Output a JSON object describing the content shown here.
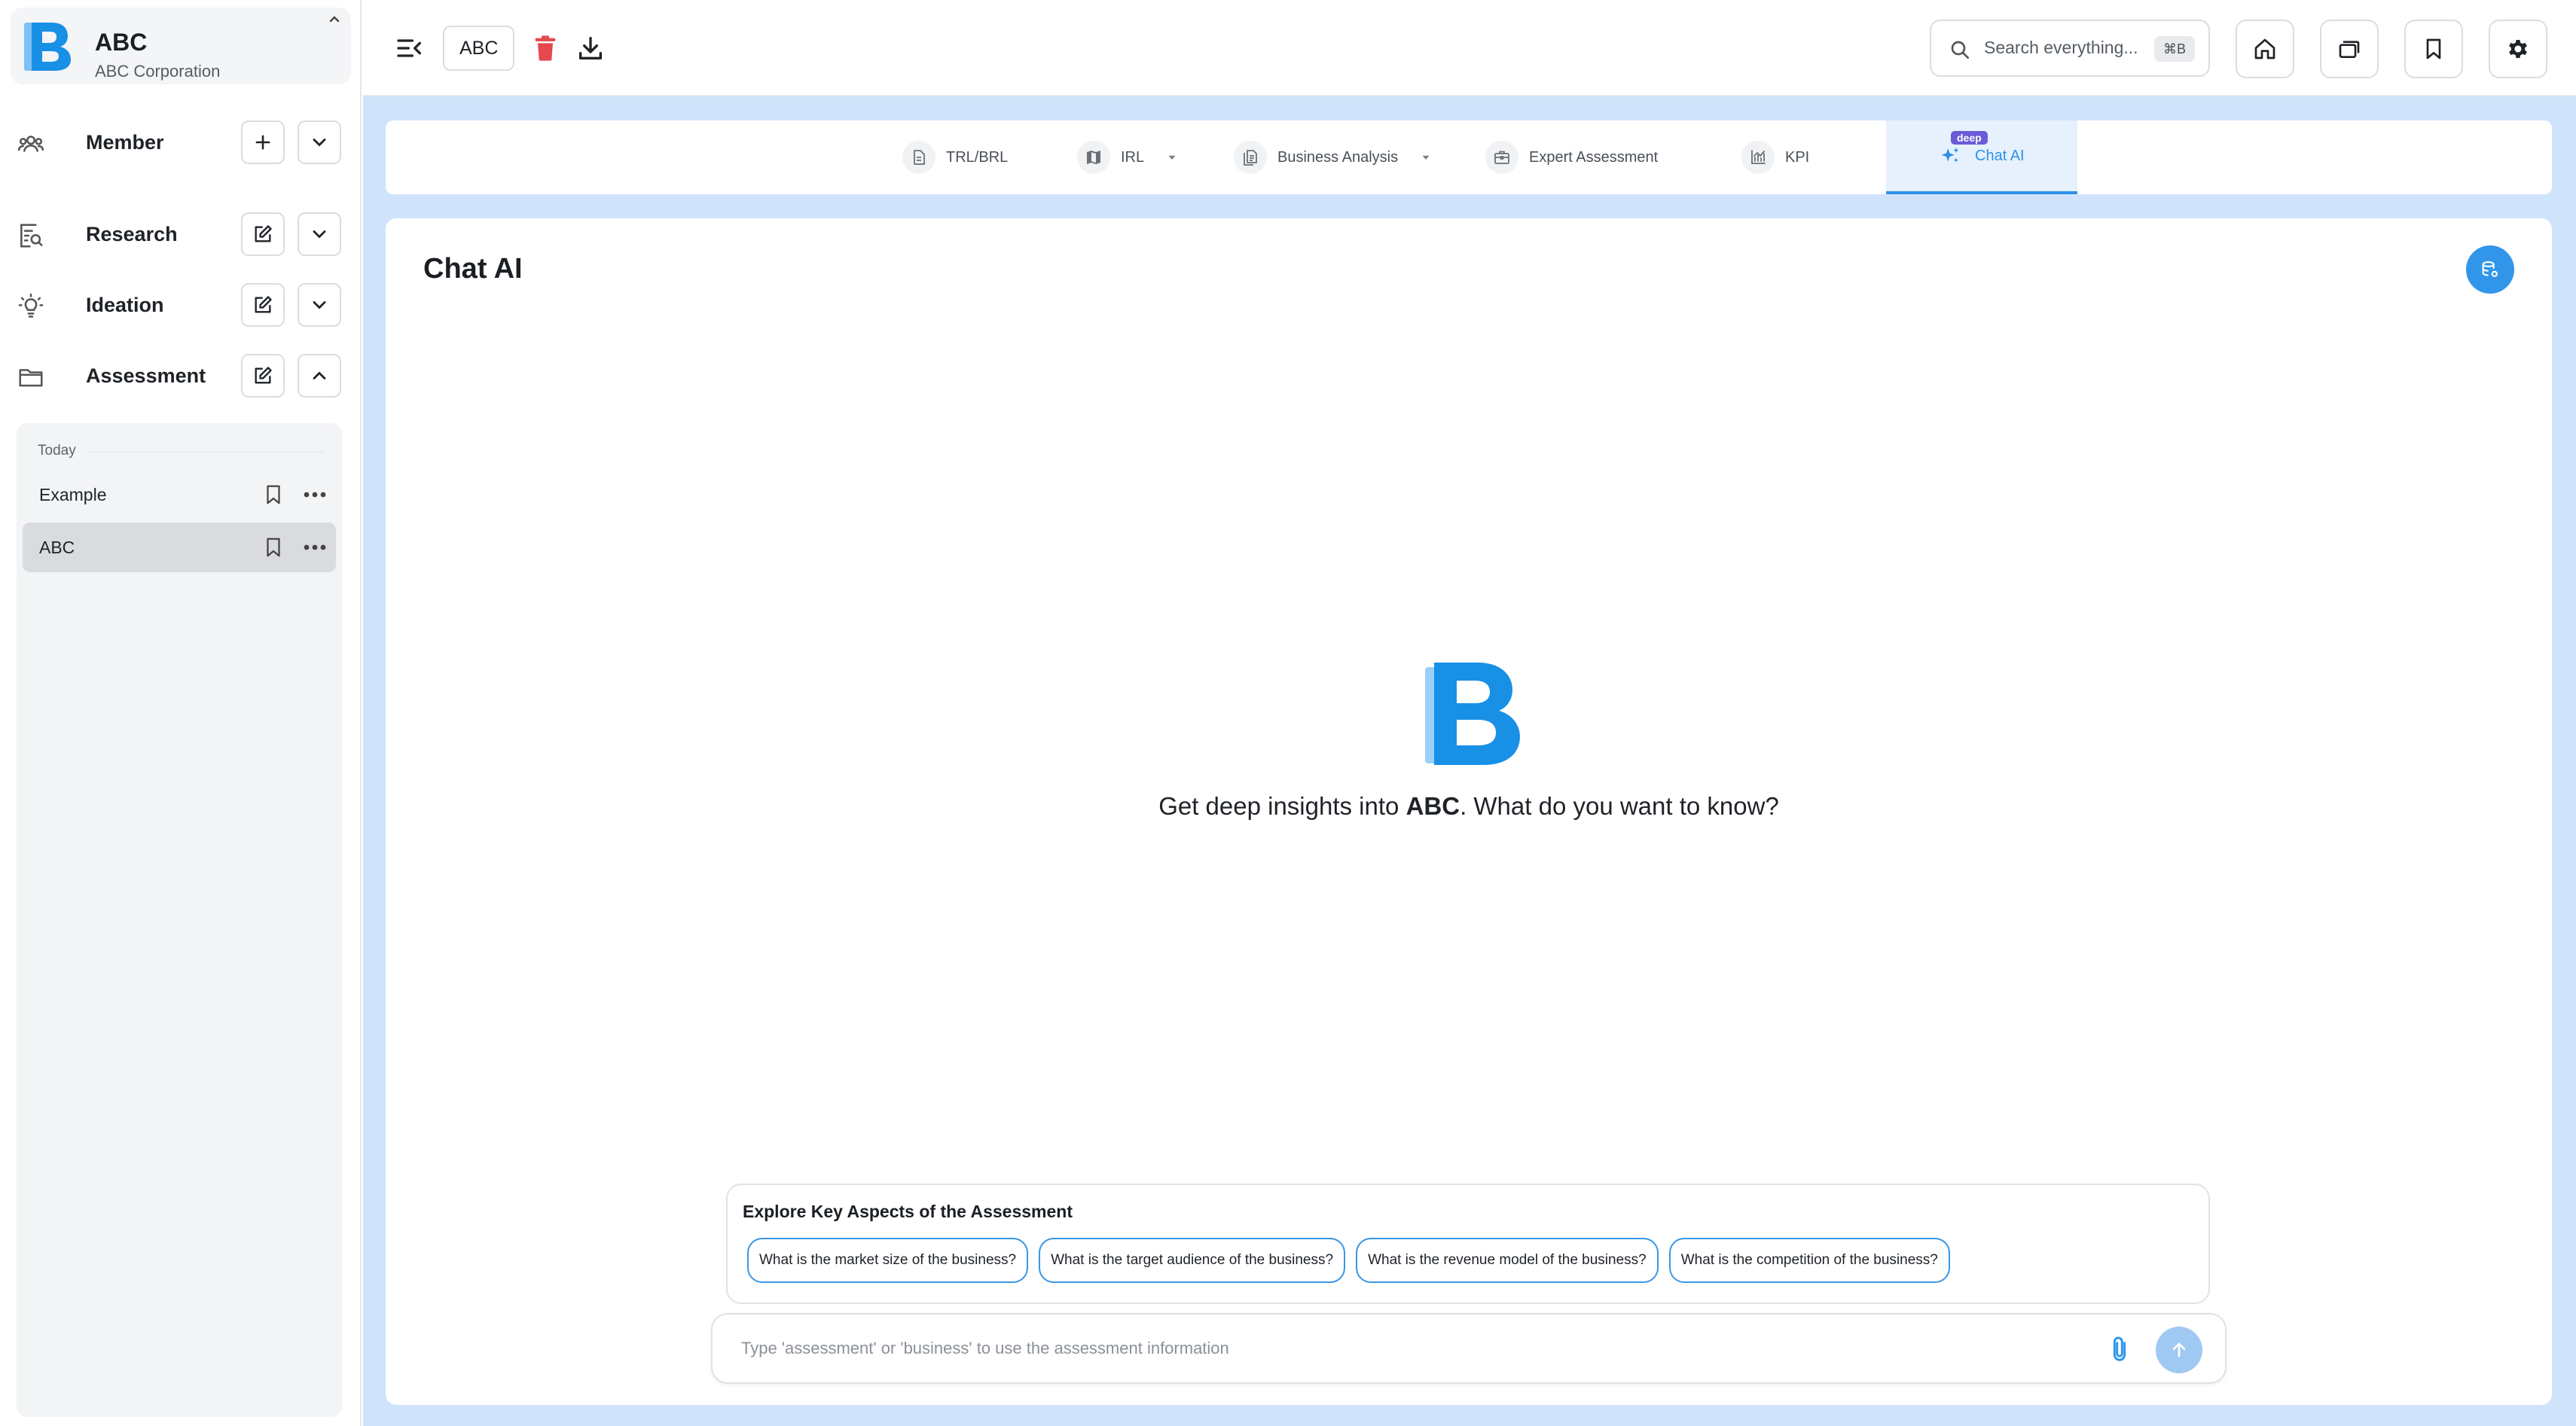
{
  "org": {
    "name": "ABC",
    "subtitle": "ABC Corporation"
  },
  "sidebar": {
    "sections": [
      {
        "label": "Member"
      },
      {
        "label": "Research"
      },
      {
        "label": "Ideation"
      },
      {
        "label": "Assessment"
      }
    ],
    "recent": {
      "group_label": "Today",
      "items": [
        {
          "label": "Example"
        },
        {
          "label": "ABC"
        }
      ]
    }
  },
  "topbar": {
    "doc_name": "ABC",
    "search_placeholder": "Search everything...",
    "search_shortcut": "⌘B"
  },
  "tabs": [
    {
      "label": "TRL/BRL"
    },
    {
      "label": "IRL"
    },
    {
      "label": "Business Analysis"
    },
    {
      "label": "Expert Assessment"
    },
    {
      "label": "KPI"
    },
    {
      "label": "Chat AI",
      "badge": "deep"
    }
  ],
  "chat": {
    "title": "Chat AI",
    "hero_prefix": "Get deep insights into ",
    "hero_company": "ABC",
    "hero_suffix": ". What do you want to know?",
    "explore_title": "Explore Key Aspects of the Assessment",
    "suggestions": [
      "What is the market size of the business?",
      "What is the target audience of the business?",
      "What is the revenue model of the business?",
      "What is the competition of the business?"
    ],
    "input_placeholder": "Type 'assessment' or 'business' to use the assessment information"
  },
  "colors": {
    "accent": "#2e91e8",
    "delete": "#e5484d",
    "main_bg": "#cfe4fb",
    "badge": "#6b5bd6"
  }
}
